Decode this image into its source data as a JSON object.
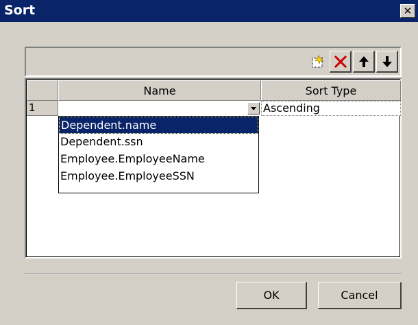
{
  "window": {
    "title": "Sort",
    "close_glyph": "✕"
  },
  "toolbar": {
    "buttons": [
      {
        "name": "new-icon"
      },
      {
        "name": "delete-icon",
        "color": "#cc0000"
      },
      {
        "name": "move-up-icon"
      },
      {
        "name": "move-down-icon"
      }
    ]
  },
  "grid": {
    "columns": [
      "Name",
      "Sort Type"
    ],
    "rows": [
      {
        "num": "1",
        "name": "",
        "sort_type": "Ascending"
      }
    ]
  },
  "dropdown": {
    "options": [
      "Dependent.name",
      "Dependent.ssn",
      "Employee.EmployeeName",
      "Employee.EmployeeSSN"
    ],
    "selected_index": 0
  },
  "buttons": {
    "ok": "OK",
    "cancel": "Cancel"
  },
  "colors": {
    "title_bar": "#0a246a",
    "face": "#d4d0c8",
    "selection": "#0a246a"
  }
}
